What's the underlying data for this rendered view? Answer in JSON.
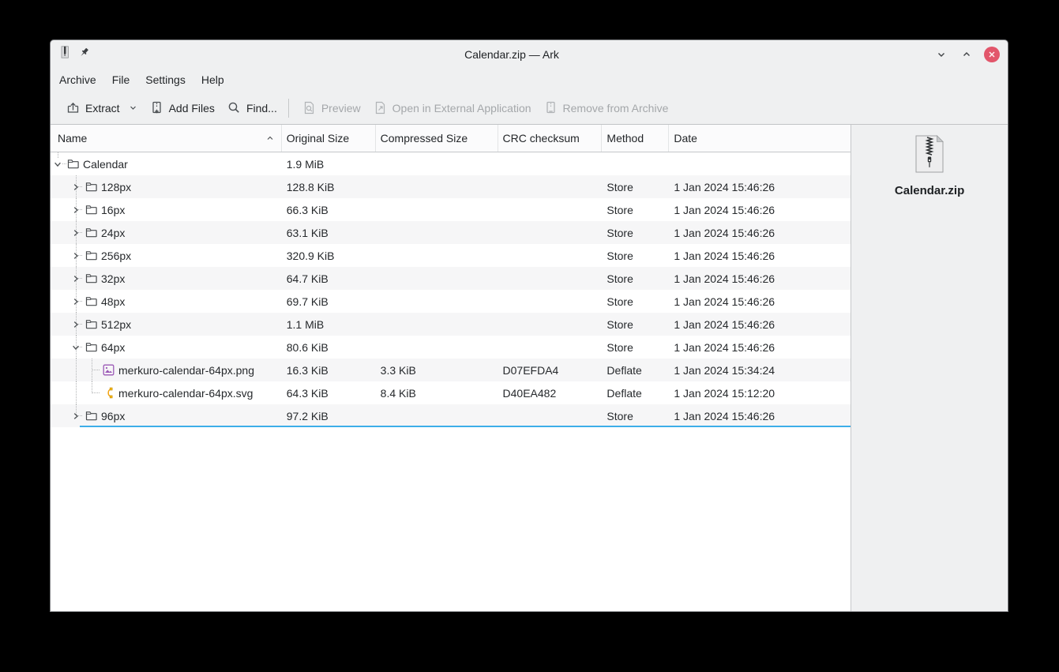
{
  "title_bar": {
    "title": "Calendar.zip — Ark",
    "icons": [
      "zip-archive-icon",
      "pin-icon"
    ],
    "controls": [
      "minimize",
      "maximize",
      "close"
    ]
  },
  "menu_bar": {
    "items": [
      "Archive",
      "File",
      "Settings",
      "Help"
    ]
  },
  "toolbar": {
    "extract": "Extract",
    "add_files": "Add Files",
    "find": "Find...",
    "preview": "Preview",
    "open_external": "Open in External Application",
    "remove": "Remove from Archive"
  },
  "filetree": {
    "columns": [
      "Name",
      "Original Size",
      "Compressed Size",
      "CRC checksum",
      "Method",
      "Date"
    ],
    "sort_column": "Name",
    "sort_order": "ascending",
    "rows": [
      {
        "name": "Calendar",
        "icon": "folder-icon",
        "level": 0,
        "expanded": true,
        "original_size": "1.9 MiB",
        "compressed_size": "",
        "crc": "",
        "method": "",
        "date": ""
      },
      {
        "name": "128px",
        "icon": "folder-icon",
        "level": 1,
        "expanded": false,
        "original_size": "128.8 KiB",
        "compressed_size": "",
        "crc": "",
        "method": "Store",
        "date": "1 Jan 2024 15:46:26"
      },
      {
        "name": "16px",
        "icon": "folder-icon",
        "level": 1,
        "expanded": false,
        "original_size": "66.3 KiB",
        "compressed_size": "",
        "crc": "",
        "method": "Store",
        "date": "1 Jan 2024 15:46:26"
      },
      {
        "name": "24px",
        "icon": "folder-icon",
        "level": 1,
        "expanded": false,
        "original_size": "63.1 KiB",
        "compressed_size": "",
        "crc": "",
        "method": "Store",
        "date": "1 Jan 2024 15:46:26"
      },
      {
        "name": "256px",
        "icon": "folder-icon",
        "level": 1,
        "expanded": false,
        "original_size": "320.9 KiB",
        "compressed_size": "",
        "crc": "",
        "method": "Store",
        "date": "1 Jan 2024 15:46:26"
      },
      {
        "name": "32px",
        "icon": "folder-icon",
        "level": 1,
        "expanded": false,
        "original_size": "64.7 KiB",
        "compressed_size": "",
        "crc": "",
        "method": "Store",
        "date": "1 Jan 2024 15:46:26"
      },
      {
        "name": "48px",
        "icon": "folder-icon",
        "level": 1,
        "expanded": false,
        "original_size": "69.7 KiB",
        "compressed_size": "",
        "crc": "",
        "method": "Store",
        "date": "1 Jan 2024 15:46:26"
      },
      {
        "name": "512px",
        "icon": "folder-icon",
        "level": 1,
        "expanded": false,
        "original_size": "1.1 MiB",
        "compressed_size": "",
        "crc": "",
        "method": "Store",
        "date": "1 Jan 2024 15:46:26"
      },
      {
        "name": "64px",
        "icon": "folder-icon",
        "level": 1,
        "expanded": true,
        "original_size": "80.6 KiB",
        "compressed_size": "",
        "crc": "",
        "method": "Store",
        "date": "1 Jan 2024 15:46:26"
      },
      {
        "name": "merkuro-calendar-64px.png",
        "icon": "image-file-icon",
        "level": 2,
        "original_size": "16.3 KiB",
        "compressed_size": "3.3 KiB",
        "crc": "D07EFDA4",
        "method": "Deflate",
        "date": "1 Jan 2024 15:34:24"
      },
      {
        "name": "merkuro-calendar-64px.svg",
        "icon": "svg-file-icon",
        "level": 2,
        "original_size": "64.3 KiB",
        "compressed_size": "8.4 KiB",
        "crc": "D40EA482",
        "method": "Deflate",
        "date": "1 Jan 2024 15:12:20"
      },
      {
        "name": "96px",
        "icon": "folder-icon",
        "level": 1,
        "expanded": false,
        "original_size": "97.2 KiB",
        "compressed_size": "",
        "crc": "",
        "method": "Store",
        "date": "1 Jan 2024 15:46:26"
      }
    ]
  },
  "sidebar": {
    "filename": "Calendar.zip",
    "icon": "zip-archive-icon"
  },
  "colors": {
    "accent": "#3daee9",
    "close_button": "#e2566b",
    "window_bg": "#eff0f1",
    "alt_row": "#f6f6f7",
    "selection_line": "#3daee9"
  }
}
